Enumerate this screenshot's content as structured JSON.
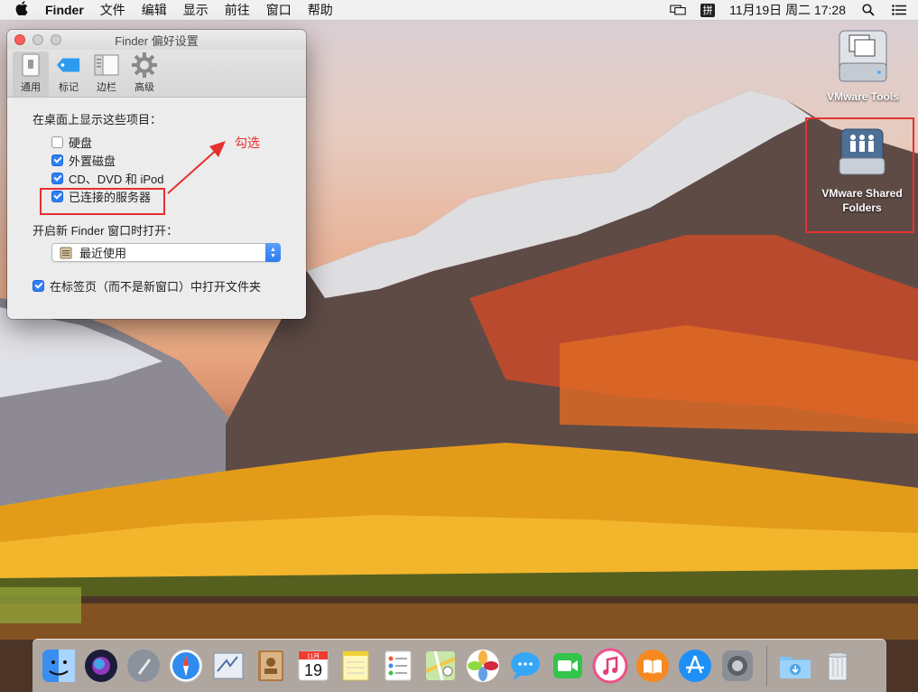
{
  "menubar": {
    "apple": "",
    "app_name": "Finder",
    "menus": [
      "文件",
      "编辑",
      "显示",
      "前往",
      "窗口",
      "帮助"
    ],
    "status": {
      "input_method": "拼",
      "clock": "11月19日 周二  17:28"
    }
  },
  "prefs_window": {
    "title": "Finder 偏好设置",
    "tabs": [
      {
        "label": "通用",
        "icon": "general-switch-icon",
        "active": true
      },
      {
        "label": "标记",
        "icon": "tag-icon",
        "active": false
      },
      {
        "label": "边栏",
        "icon": "sidebar-icon",
        "active": false
      },
      {
        "label": "高级",
        "icon": "gear-icon",
        "active": false
      }
    ],
    "desktop_section_label": "在桌面上显示这些项目：",
    "desktop_items": [
      {
        "label": "硬盘",
        "checked": false
      },
      {
        "label": "外置磁盘",
        "checked": true
      },
      {
        "label": "CD、DVD 和 iPod",
        "checked": true
      },
      {
        "label": "已连接的服务器",
        "checked": true
      }
    ],
    "new_window_label": "开启新 Finder 窗口时打开：",
    "new_window_value": "最近使用",
    "tabs_option": {
      "label": "在标签页（而不是新窗口）中打开文件夹",
      "checked": true
    }
  },
  "annotation": {
    "text": "勾选",
    "color": "#e63030"
  },
  "desktop_icons": [
    {
      "label": "VMware Tools",
      "icon": "disk-drive-icon"
    },
    {
      "label_line1": "VMware Shared",
      "label_line2": "Folders",
      "icon": "shared-folders-icon"
    }
  ],
  "dock": {
    "apps": [
      "finder-icon",
      "siri-icon",
      "launchpad-icon",
      "safari-icon",
      "mail-icon",
      "contacts-icon",
      "calendar-icon",
      "notes-icon",
      "reminders-icon",
      "maps-icon",
      "photos-icon",
      "messages-icon",
      "facetime-icon",
      "itunes-icon",
      "ibooks-icon",
      "app-store-icon",
      "system-preferences-icon"
    ],
    "calendar_month": "11月",
    "calendar_day": "19",
    "trailing": [
      "downloads-folder-icon",
      "trash-icon"
    ]
  },
  "colors": {
    "accent": "#2f7ef7",
    "annotation": "#e63030"
  }
}
